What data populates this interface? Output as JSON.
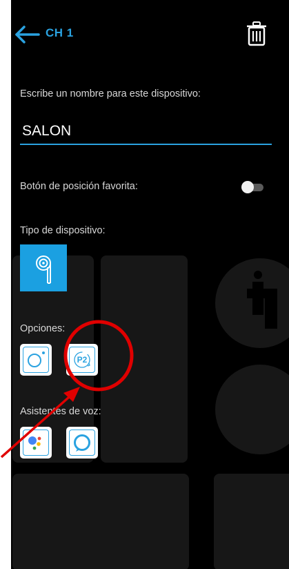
{
  "header": {
    "title": "CH 1"
  },
  "form": {
    "name_label": "Escribe un nombre para este dispositivo:",
    "name_value": "SALON",
    "favorite_label": "Botón de posición favorita:",
    "favorite_enabled": false,
    "device_type_label": "Tipo de dispositivo:",
    "options_label": "Opciones:",
    "option_p2_text": "P2",
    "voice_label": "Asistentes de voz:"
  },
  "colors": {
    "accent": "#2aa2e0",
    "annotation": "#e00000",
    "background": "#000000"
  },
  "icons": [
    "back-arrow-icon",
    "trash-icon",
    "blind-device-icon",
    "circle-option-icon",
    "p2-option-icon",
    "google-assistant-icon",
    "alexa-icon"
  ]
}
